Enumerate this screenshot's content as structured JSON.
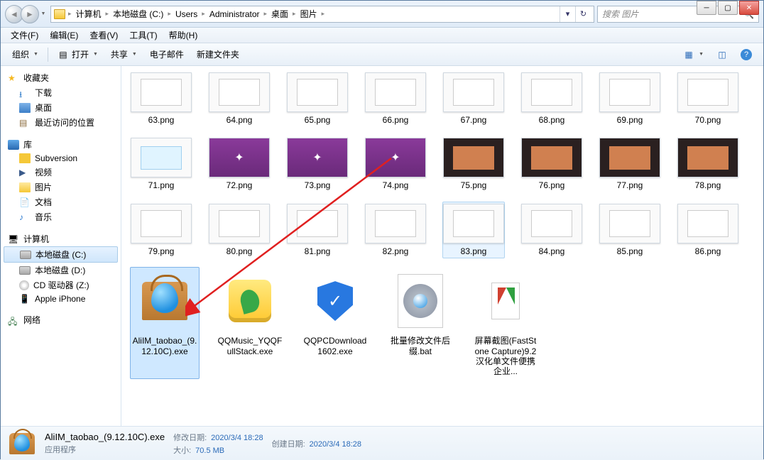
{
  "breadcrumb": [
    "计算机",
    "本地磁盘 (C:)",
    "Users",
    "Administrator",
    "桌面",
    "图片"
  ],
  "search_placeholder": "搜索 图片",
  "menubar": [
    {
      "label": "文件(F)"
    },
    {
      "label": "编辑(E)"
    },
    {
      "label": "查看(V)"
    },
    {
      "label": "工具(T)"
    },
    {
      "label": "帮助(H)"
    }
  ],
  "toolbar": {
    "organize": "组织",
    "open": "打开",
    "share": "共享",
    "email": "电子邮件",
    "newfolder": "新建文件夹"
  },
  "sidebar": {
    "favorites": {
      "label": "收藏夹",
      "items": [
        {
          "label": "下载"
        },
        {
          "label": "桌面"
        },
        {
          "label": "最近访问的位置"
        }
      ]
    },
    "libraries": {
      "label": "库",
      "items": [
        {
          "label": "Subversion"
        },
        {
          "label": "视频"
        },
        {
          "label": "图片"
        },
        {
          "label": "文档"
        },
        {
          "label": "音乐"
        }
      ]
    },
    "computer": {
      "label": "计算机",
      "items": [
        {
          "label": "本地磁盘 (C:)",
          "selected": true
        },
        {
          "label": "本地磁盘 (D:)"
        },
        {
          "label": "CD 驱动器 (Z:)"
        },
        {
          "label": "Apple iPhone"
        }
      ]
    },
    "network": {
      "label": "网络"
    }
  },
  "files_row1": [
    {
      "name": "63.png",
      "style": "white"
    },
    {
      "name": "64.png",
      "style": "white"
    },
    {
      "name": "65.png",
      "style": "white"
    },
    {
      "name": "66.png",
      "style": "white"
    },
    {
      "name": "67.png",
      "style": "white"
    },
    {
      "name": "68.png",
      "style": "white"
    },
    {
      "name": "69.png",
      "style": "white"
    },
    {
      "name": "70.png",
      "style": "white"
    }
  ],
  "files_row2": [
    {
      "name": "71.png",
      "style": "blue"
    },
    {
      "name": "72.png",
      "style": "purple"
    },
    {
      "name": "73.png",
      "style": "purple"
    },
    {
      "name": "74.png",
      "style": "purple"
    },
    {
      "name": "75.png",
      "style": "dark"
    },
    {
      "name": "76.png",
      "style": "dark"
    },
    {
      "name": "77.png",
      "style": "dark"
    },
    {
      "name": "78.png",
      "style": "dark"
    }
  ],
  "files_row3": [
    {
      "name": "79.png",
      "style": "white"
    },
    {
      "name": "80.png",
      "style": "white"
    },
    {
      "name": "81.png",
      "style": "white"
    },
    {
      "name": "82.png",
      "style": "white"
    },
    {
      "name": "83.png",
      "style": "white",
      "hover": true
    },
    {
      "name": "84.png",
      "style": "white"
    },
    {
      "name": "85.png",
      "style": "white"
    },
    {
      "name": "86.png",
      "style": "white"
    }
  ],
  "files_row4": [
    {
      "name": "AliIM_taobao_(9.12.10C).exe",
      "icon": "aliim",
      "selected": true
    },
    {
      "name": "QQMusic_YQQFullStack.exe",
      "icon": "qqmusic"
    },
    {
      "name": "QQPCDownload1602.exe",
      "icon": "qqpc"
    },
    {
      "name": "批量修改文件后缀.bat",
      "icon": "bat"
    },
    {
      "name": "屏幕截图(FastStone Capture)9.2汉化单文件便携企业...",
      "icon": "faststone"
    }
  ],
  "details": {
    "filename": "AliIM_taobao_(9.12.10C).exe",
    "filetype": "应用程序",
    "mod_label": "修改日期:",
    "mod_value": "2020/3/4 18:28",
    "create_label": "创建日期:",
    "create_value": "2020/3/4 18:28",
    "size_label": "大小:",
    "size_value": "70.5 MB"
  }
}
